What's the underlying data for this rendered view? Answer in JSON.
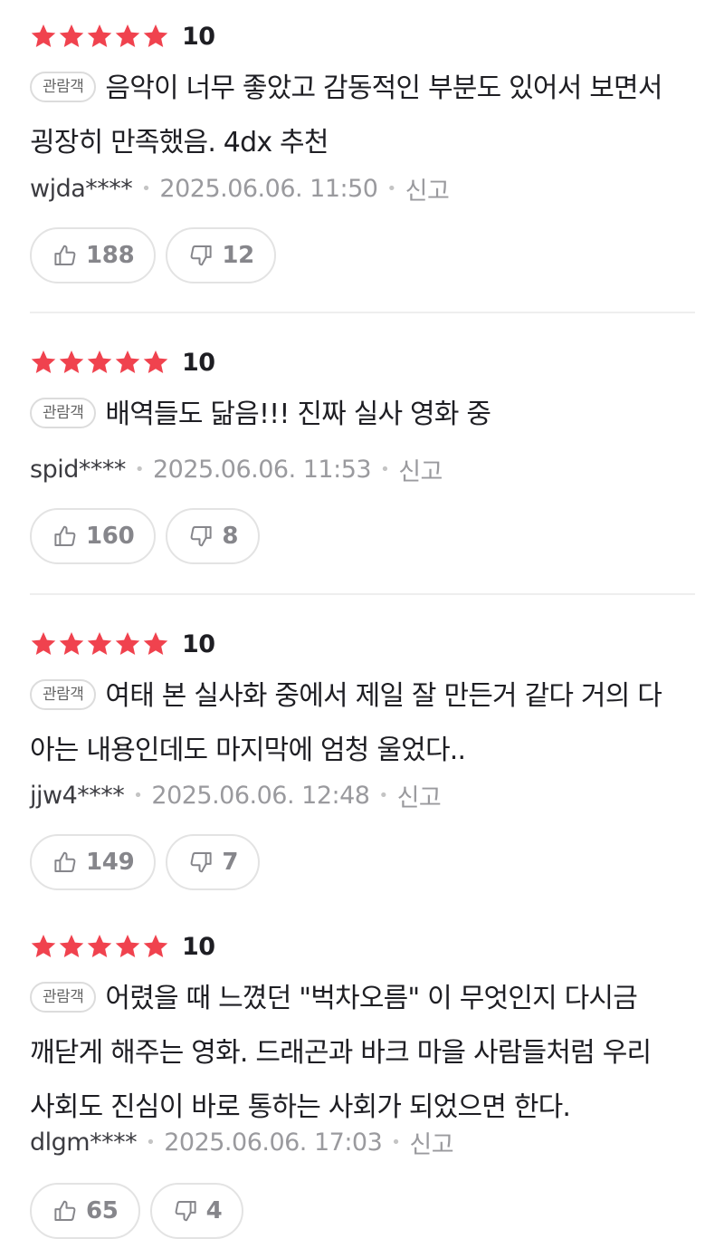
{
  "colors": {
    "star": "#f0424e",
    "text": "#1e1e23",
    "muted": "#9a9a9e",
    "border": "#e3e3e3"
  },
  "icons": {
    "star": "star-icon",
    "like": "thumbs-up-icon",
    "dislike": "thumbs-down-icon"
  },
  "reviews": [
    {
      "stars": 5,
      "score": "10",
      "badge": "관람객",
      "content": "음악이 너무 좋았고 감동적인 부분도 있어서 보면서 굉장히 만족했음. 4dx 추천",
      "author": "wjda****",
      "date": "2025.06.06. 11:50",
      "report": "신고",
      "likes": "188",
      "dislikes": "12"
    },
    {
      "stars": 5,
      "score": "10",
      "badge": "관람객",
      "content": "배역들도 닮음!!! 진짜 실사 영화 중",
      "author": "spid****",
      "date": "2025.06.06. 11:53",
      "report": "신고",
      "likes": "160",
      "dislikes": "8"
    },
    {
      "stars": 5,
      "score": "10",
      "badge": "관람객",
      "content": "여태 본 실사화 중에서 제일 잘 만든거 같다 거의 다 아는 내용인데도 마지막에 엄청 울었다..",
      "author": "jjw4****",
      "date": "2025.06.06. 12:48",
      "report": "신고",
      "likes": "149",
      "dislikes": "7"
    },
    {
      "stars": 5,
      "score": "10",
      "badge": "관람객",
      "content": "어렸을 때 느꼈던 \"벅차오름\" 이 무엇인지 다시금 깨닫게 해주는 영화. 드래곤과 바크 마을 사람들처럼 우리 사회도 진심이 바로 통하는 사회가 되었으면 한다.",
      "author": "dlgm****",
      "date": "2025.06.06. 17:03",
      "report": "신고",
      "likes": "65",
      "dislikes": "4"
    }
  ]
}
